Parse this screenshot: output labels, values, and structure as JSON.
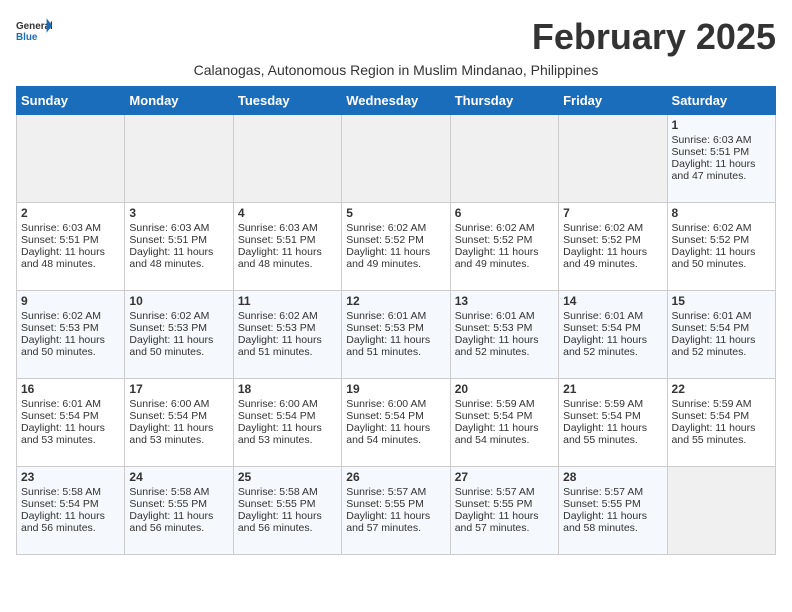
{
  "header": {
    "logo_general": "General",
    "logo_blue": "Blue",
    "month_title": "February 2025",
    "subtitle": "Calanogas, Autonomous Region in Muslim Mindanao, Philippines"
  },
  "weekdays": [
    "Sunday",
    "Monday",
    "Tuesday",
    "Wednesday",
    "Thursday",
    "Friday",
    "Saturday"
  ],
  "weeks": [
    [
      {
        "day": "",
        "info": ""
      },
      {
        "day": "",
        "info": ""
      },
      {
        "day": "",
        "info": ""
      },
      {
        "day": "",
        "info": ""
      },
      {
        "day": "",
        "info": ""
      },
      {
        "day": "",
        "info": ""
      },
      {
        "day": "1",
        "info": "Sunrise: 6:03 AM\nSunset: 5:51 PM\nDaylight: 11 hours and 47 minutes."
      }
    ],
    [
      {
        "day": "2",
        "info": "Sunrise: 6:03 AM\nSunset: 5:51 PM\nDaylight: 11 hours and 48 minutes."
      },
      {
        "day": "3",
        "info": "Sunrise: 6:03 AM\nSunset: 5:51 PM\nDaylight: 11 hours and 48 minutes."
      },
      {
        "day": "4",
        "info": "Sunrise: 6:03 AM\nSunset: 5:51 PM\nDaylight: 11 hours and 48 minutes."
      },
      {
        "day": "5",
        "info": "Sunrise: 6:02 AM\nSunset: 5:52 PM\nDaylight: 11 hours and 49 minutes."
      },
      {
        "day": "6",
        "info": "Sunrise: 6:02 AM\nSunset: 5:52 PM\nDaylight: 11 hours and 49 minutes."
      },
      {
        "day": "7",
        "info": "Sunrise: 6:02 AM\nSunset: 5:52 PM\nDaylight: 11 hours and 49 minutes."
      },
      {
        "day": "8",
        "info": "Sunrise: 6:02 AM\nSunset: 5:52 PM\nDaylight: 11 hours and 50 minutes."
      }
    ],
    [
      {
        "day": "9",
        "info": "Sunrise: 6:02 AM\nSunset: 5:53 PM\nDaylight: 11 hours and 50 minutes."
      },
      {
        "day": "10",
        "info": "Sunrise: 6:02 AM\nSunset: 5:53 PM\nDaylight: 11 hours and 50 minutes."
      },
      {
        "day": "11",
        "info": "Sunrise: 6:02 AM\nSunset: 5:53 PM\nDaylight: 11 hours and 51 minutes."
      },
      {
        "day": "12",
        "info": "Sunrise: 6:01 AM\nSunset: 5:53 PM\nDaylight: 11 hours and 51 minutes."
      },
      {
        "day": "13",
        "info": "Sunrise: 6:01 AM\nSunset: 5:53 PM\nDaylight: 11 hours and 52 minutes."
      },
      {
        "day": "14",
        "info": "Sunrise: 6:01 AM\nSunset: 5:54 PM\nDaylight: 11 hours and 52 minutes."
      },
      {
        "day": "15",
        "info": "Sunrise: 6:01 AM\nSunset: 5:54 PM\nDaylight: 11 hours and 52 minutes."
      }
    ],
    [
      {
        "day": "16",
        "info": "Sunrise: 6:01 AM\nSunset: 5:54 PM\nDaylight: 11 hours and 53 minutes."
      },
      {
        "day": "17",
        "info": "Sunrise: 6:00 AM\nSunset: 5:54 PM\nDaylight: 11 hours and 53 minutes."
      },
      {
        "day": "18",
        "info": "Sunrise: 6:00 AM\nSunset: 5:54 PM\nDaylight: 11 hours and 53 minutes."
      },
      {
        "day": "19",
        "info": "Sunrise: 6:00 AM\nSunset: 5:54 PM\nDaylight: 11 hours and 54 minutes."
      },
      {
        "day": "20",
        "info": "Sunrise: 5:59 AM\nSunset: 5:54 PM\nDaylight: 11 hours and 54 minutes."
      },
      {
        "day": "21",
        "info": "Sunrise: 5:59 AM\nSunset: 5:54 PM\nDaylight: 11 hours and 55 minutes."
      },
      {
        "day": "22",
        "info": "Sunrise: 5:59 AM\nSunset: 5:54 PM\nDaylight: 11 hours and 55 minutes."
      }
    ],
    [
      {
        "day": "23",
        "info": "Sunrise: 5:58 AM\nSunset: 5:54 PM\nDaylight: 11 hours and 56 minutes."
      },
      {
        "day": "24",
        "info": "Sunrise: 5:58 AM\nSunset: 5:55 PM\nDaylight: 11 hours and 56 minutes."
      },
      {
        "day": "25",
        "info": "Sunrise: 5:58 AM\nSunset: 5:55 PM\nDaylight: 11 hours and 56 minutes."
      },
      {
        "day": "26",
        "info": "Sunrise: 5:57 AM\nSunset: 5:55 PM\nDaylight: 11 hours and 57 minutes."
      },
      {
        "day": "27",
        "info": "Sunrise: 5:57 AM\nSunset: 5:55 PM\nDaylight: 11 hours and 57 minutes."
      },
      {
        "day": "28",
        "info": "Sunrise: 5:57 AM\nSunset: 5:55 PM\nDaylight: 11 hours and 58 minutes."
      },
      {
        "day": "",
        "info": ""
      }
    ]
  ]
}
